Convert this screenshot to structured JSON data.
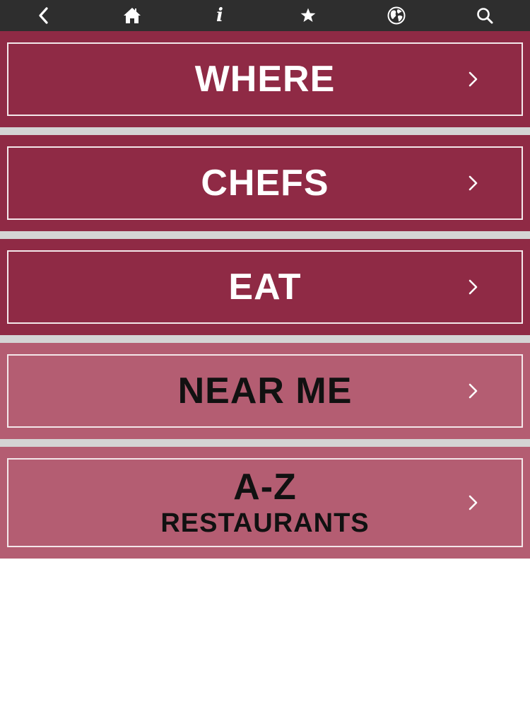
{
  "toolbar": {
    "background": "#2e2e2e",
    "icons": [
      "back-icon",
      "home-icon",
      "info-icon",
      "star-icon",
      "globe-icon",
      "search-icon"
    ],
    "info_glyph": "i"
  },
  "colors": {
    "dark_row": "#8f2a45",
    "light_row": "#b45d72",
    "separator": "#d4d4d4",
    "frame_border": "#f4e7ea",
    "dark_row_text": "#ffffff",
    "light_row_text": "#111111"
  },
  "menu": {
    "items": [
      {
        "label": "WHERE",
        "style": "dark"
      },
      {
        "label": "CHEFS",
        "style": "dark"
      },
      {
        "label": "EAT",
        "style": "dark"
      },
      {
        "label": "NEAR ME",
        "style": "light"
      },
      {
        "label": "A-Z",
        "sublabel": "RESTAURANTS",
        "style": "light"
      }
    ]
  }
}
